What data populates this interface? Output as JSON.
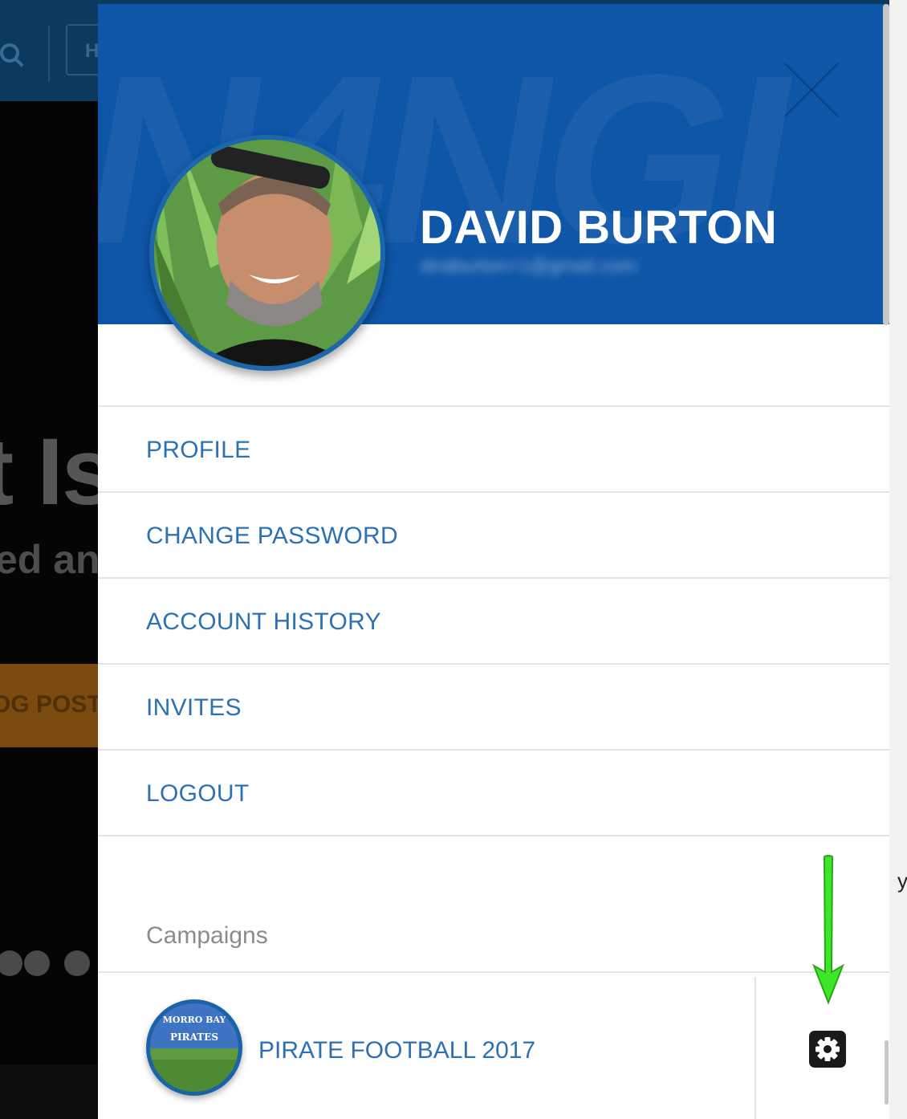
{
  "background": {
    "top_button_label": "H",
    "headline": "t Is",
    "subline": "ed and",
    "cta": "OG POST"
  },
  "drawer": {
    "user": {
      "name": "DAVID BURTON",
      "email": "dnaburton+1@gmail.com"
    },
    "menu": [
      {
        "label": "PROFILE"
      },
      {
        "label": "CHANGE PASSWORD"
      },
      {
        "label": "ACCOUNT HISTORY"
      },
      {
        "label": "INVITES"
      },
      {
        "label": "LOGOUT"
      }
    ],
    "campaigns_heading": "Campaigns",
    "campaigns": [
      {
        "name": "PIRATE FOOTBALL 2017",
        "logo_text_top": "MORRO BAY",
        "logo_text_bottom": "PIRATES"
      }
    ]
  },
  "icons": {
    "close": "close-icon",
    "settings": "gear-icon",
    "search": "search-icon",
    "annotation": "arrow-down-icon"
  },
  "colors": {
    "header_blue": "#0e56a8",
    "link_blue": "#2d71b4",
    "annotation_green": "#3ee62a"
  }
}
